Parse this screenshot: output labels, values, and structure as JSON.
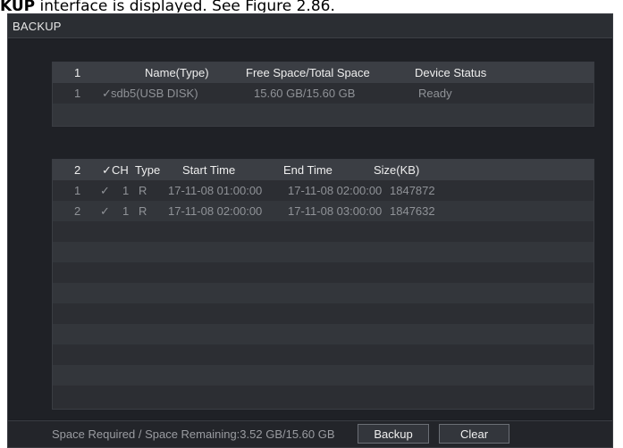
{
  "caption": {
    "prefix": "KUP",
    "suffix": " interface is displayed. See Figure 2.86."
  },
  "window": {
    "title": "BACKUP"
  },
  "device_table": {
    "header": {
      "index": "1",
      "name": "Name(Type)",
      "space": "Free Space/Total Space",
      "status": "Device Status"
    },
    "rows": [
      {
        "index": "1",
        "check": "✓",
        "name": "sdb5(USB DISK)",
        "space": "15.60 GB/15.60 GB",
        "status": "Ready"
      }
    ]
  },
  "file_table": {
    "header": {
      "index": "2",
      "check": "✓",
      "ch": "CH",
      "type": "Type",
      "start": "Start Time",
      "end": "End Time",
      "size": "Size(KB)"
    },
    "rows": [
      {
        "index": "1",
        "check": "✓",
        "ch": "1",
        "type": "R",
        "start": "17-11-08 01:00:00",
        "end": "17-11-08 02:00:00",
        "size": "1847872"
      },
      {
        "index": "2",
        "check": "✓",
        "ch": "1",
        "type": "R",
        "start": "17-11-08 02:00:00",
        "end": "17-11-08 03:00:00",
        "size": "1847632"
      }
    ]
  },
  "footer": {
    "space_label": "Space Required / Space Remaining:3.52 GB/15.60 GB",
    "backup_label": "Backup",
    "clear_label": "Clear"
  }
}
